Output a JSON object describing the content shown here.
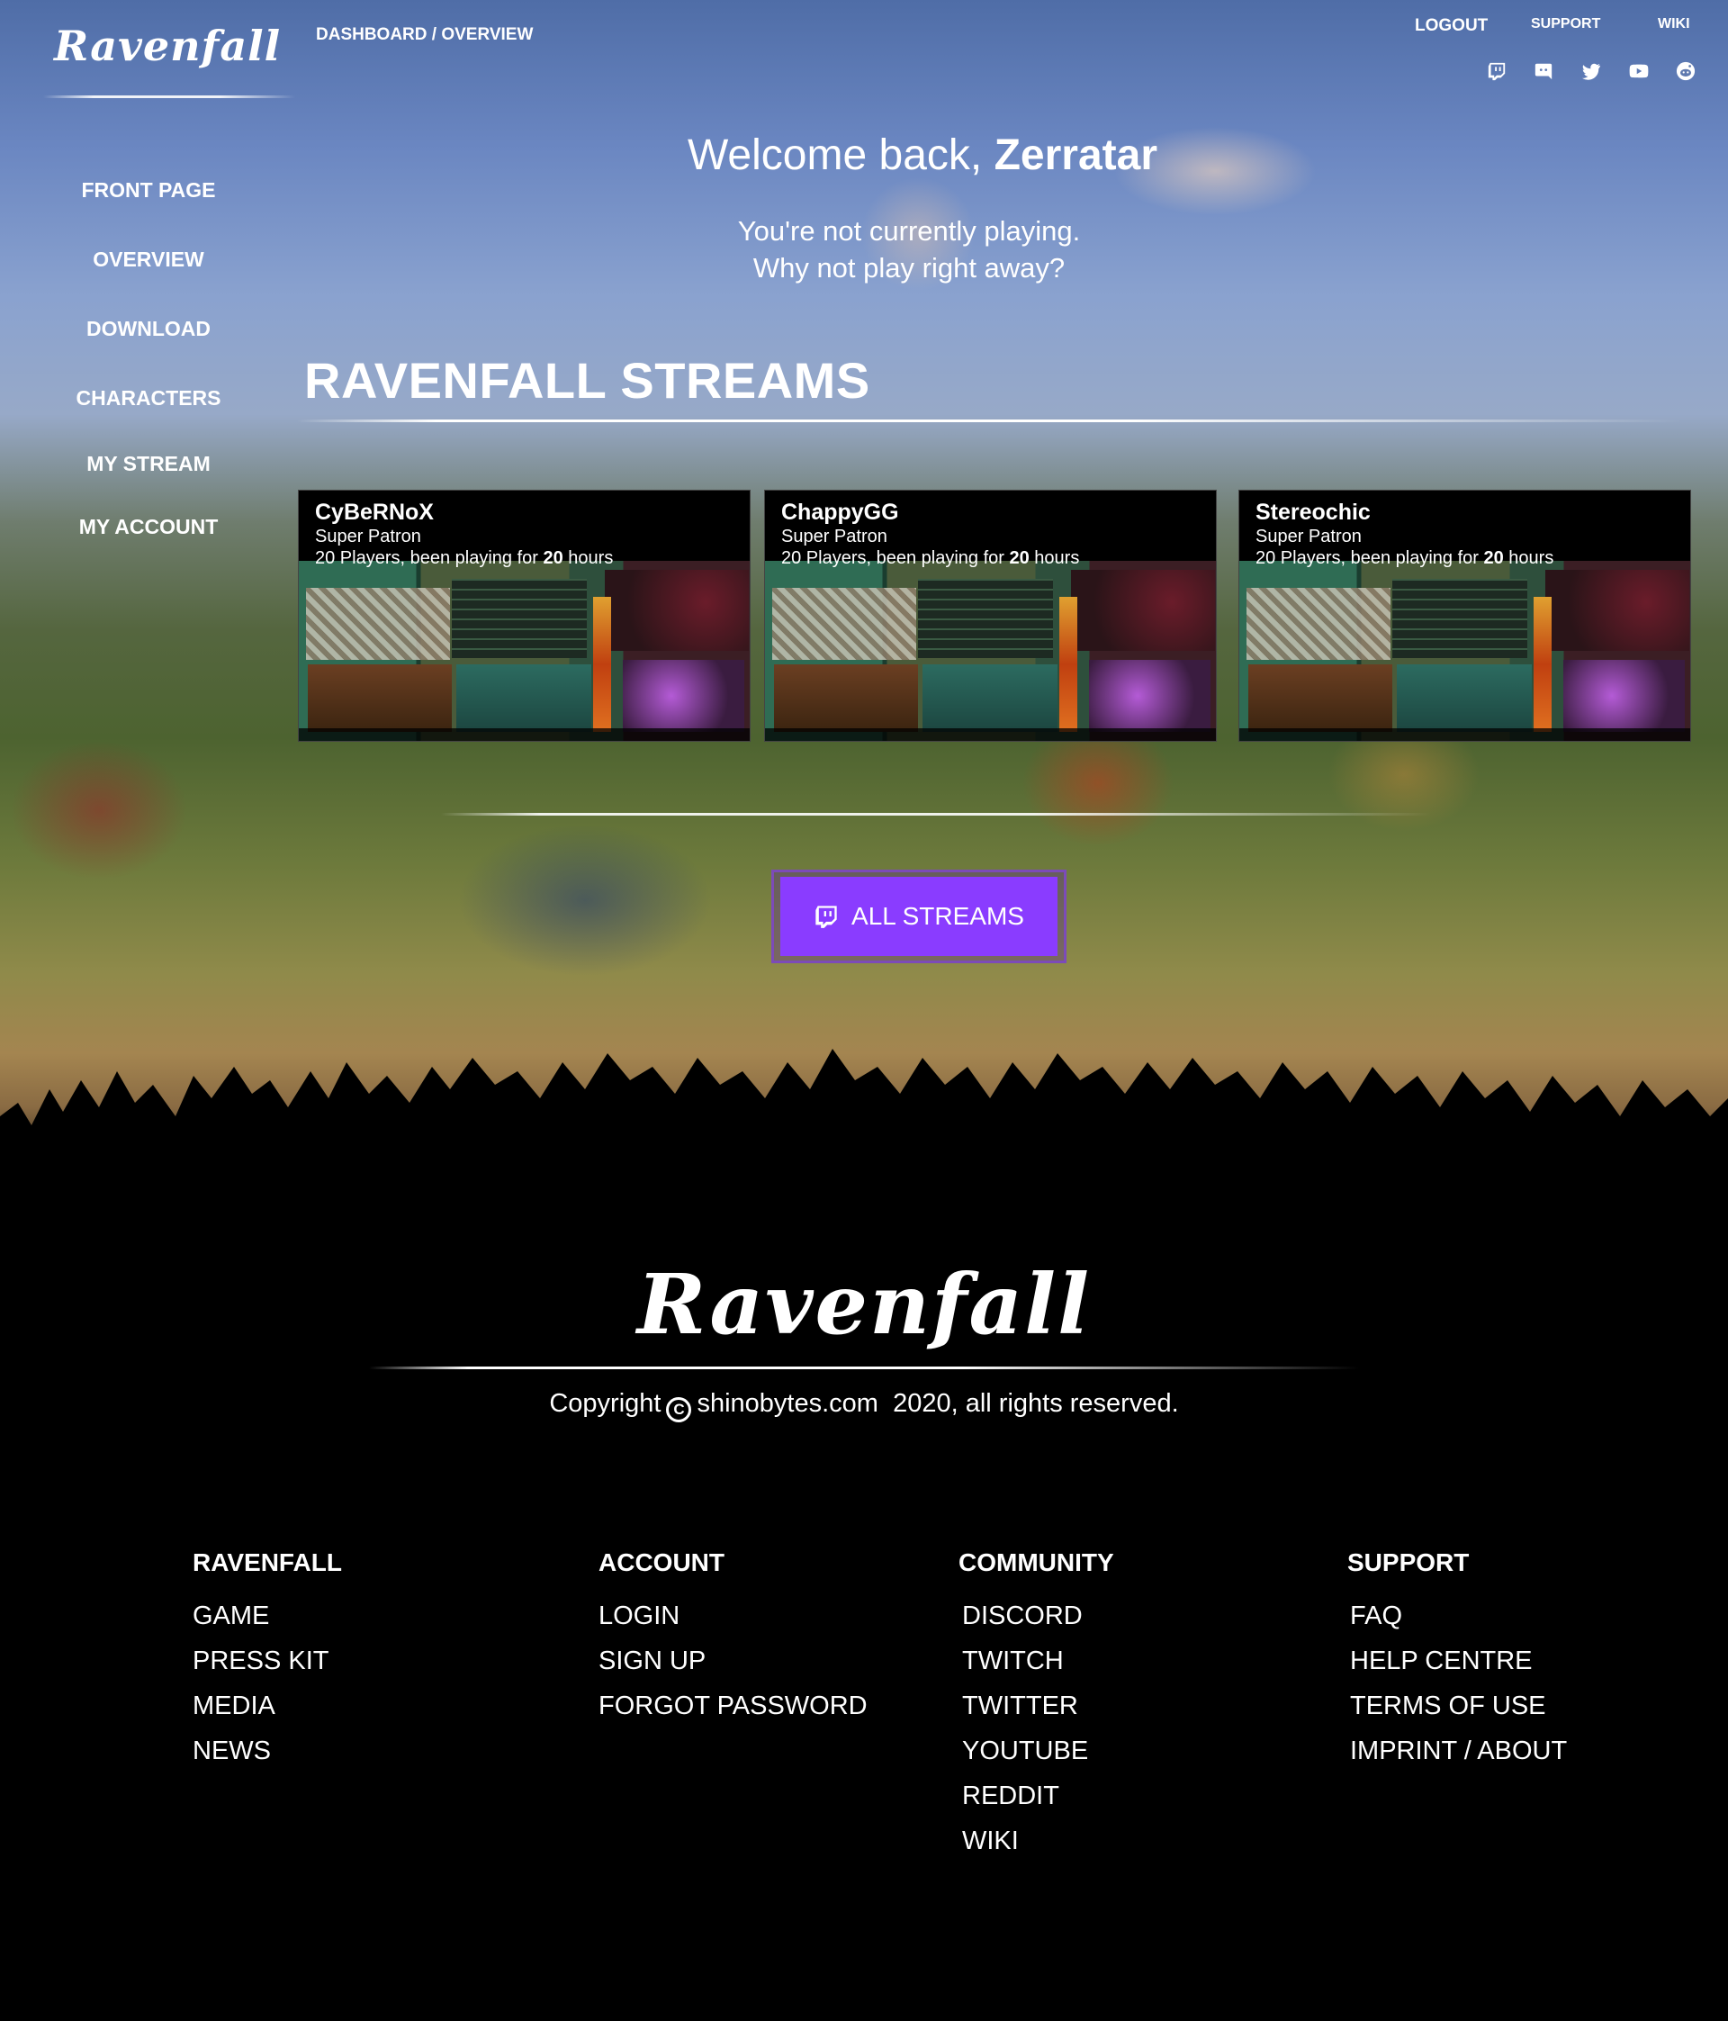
{
  "header": {
    "logo": "Ravenfall",
    "breadcrumb": "DASHBOARD / OVERVIEW",
    "links": {
      "logout": "LOGOUT",
      "support": "SUPPORT",
      "wiki": "WIKI"
    },
    "social_icons": [
      "twitch-icon",
      "discord-icon",
      "twitter-icon",
      "youtube-icon",
      "reddit-icon"
    ]
  },
  "sidebar": {
    "items": [
      {
        "label": "FRONT PAGE"
      },
      {
        "label": "OVERVIEW"
      },
      {
        "label": "DOWNLOAD"
      },
      {
        "label": "CHARACTERS"
      },
      {
        "label": "MY STREAM"
      },
      {
        "label": "MY ACCOUNT"
      }
    ]
  },
  "main": {
    "welcome_prefix": "Welcome back,",
    "username": "Zerratar",
    "subtitle_line1": "You're not currently playing.",
    "subtitle_line2": "Why not play right away?",
    "streams_title": "RAVENFALL STREAMS",
    "streams": [
      {
        "name": "CyBeRNoX",
        "tier": "Super Patron",
        "players": "20",
        "players_text": " Players, been playing for ",
        "hours": "20",
        "hours_text": " hours"
      },
      {
        "name": "ChappyGG",
        "tier": "Super Patron",
        "players": "20",
        "players_text": " Players, been playing for ",
        "hours": "20",
        "hours_text": " hours"
      },
      {
        "name": "Stereochic",
        "tier": "Super Patron",
        "players": "20",
        "players_text": " Players, been playing for ",
        "hours": "20",
        "hours_text": " hours"
      }
    ],
    "all_streams_label": "ALL STREAMS"
  },
  "footer": {
    "logo": "Ravenfall",
    "copyright_prefix": "Copyright",
    "copyright_domain": "shinobytes.com",
    "copyright_year": "2020",
    "copyright_suffix": ", all rights reserved.",
    "columns": [
      {
        "title": "RAVENFALL",
        "links": [
          "GAME",
          "PRESS KIT",
          "MEDIA",
          "NEWS"
        ]
      },
      {
        "title": "ACCOUNT",
        "links": [
          "LOGIN",
          "SIGN UP",
          "FORGOT PASSWORD"
        ]
      },
      {
        "title": "COMMUNITY",
        "links": [
          "DISCORD",
          "TWITCH",
          "TWITTER",
          "YOUTUBE",
          "REDDIT",
          "WIKI"
        ]
      },
      {
        "title": "SUPPORT",
        "links": [
          "FAQ",
          "HELP CENTRE",
          "TERMS OF USE",
          "IMPRINT / ABOUT"
        ]
      }
    ]
  },
  "colors": {
    "accent_purple": "#8a3cff",
    "background": "#000000"
  }
}
